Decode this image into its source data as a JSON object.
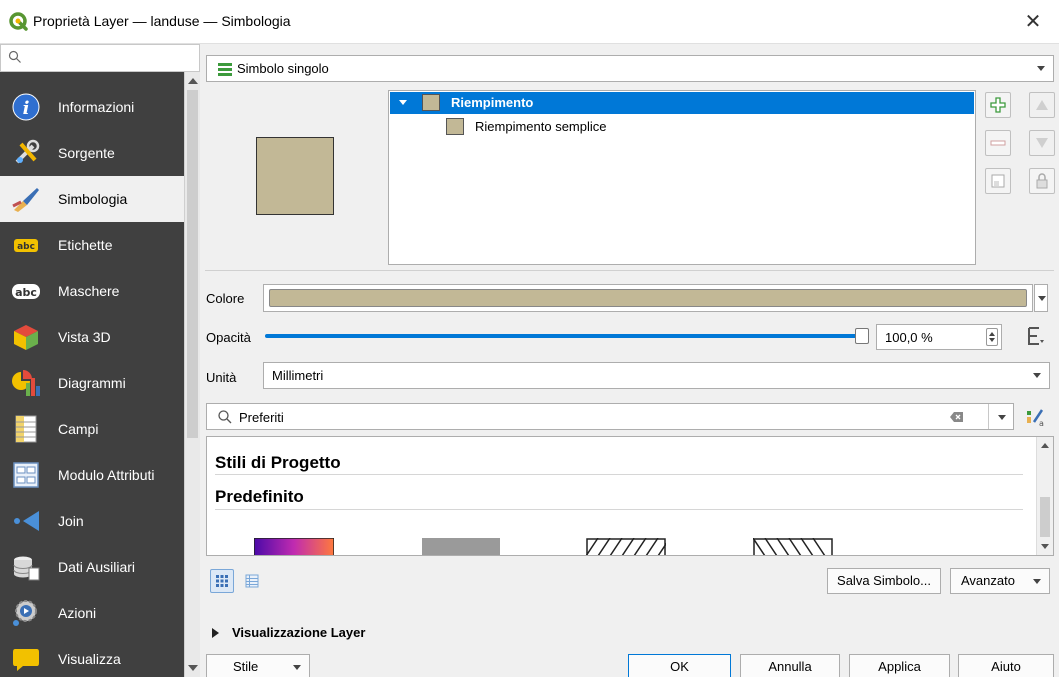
{
  "window": {
    "title": "Proprietà Layer — landuse — Simbologia",
    "close_glyph": "✕"
  },
  "sidebar": {
    "items": [
      {
        "label": "Informazioni",
        "icon": "info-icon"
      },
      {
        "label": "Sorgente",
        "icon": "source-icon"
      },
      {
        "label": "Simbologia",
        "icon": "symbology-icon",
        "active": true
      },
      {
        "label": "Etichette",
        "icon": "labels-icon"
      },
      {
        "label": "Maschere",
        "icon": "masks-icon"
      },
      {
        "label": "Vista 3D",
        "icon": "3d-view-icon"
      },
      {
        "label": "Diagrammi",
        "icon": "diagrams-icon"
      },
      {
        "label": "Campi",
        "icon": "fields-icon"
      },
      {
        "label": "Modulo Attributi",
        "icon": "attributes-form-icon"
      },
      {
        "label": "Join",
        "icon": "join-icon"
      },
      {
        "label": "Dati Ausiliari",
        "icon": "auxiliary-data-icon"
      },
      {
        "label": "Azioni",
        "icon": "actions-icon"
      },
      {
        "label": "Visualizza",
        "icon": "display-icon"
      }
    ]
  },
  "renderer": {
    "selected": "Simbolo singolo"
  },
  "symbol_tree": {
    "root": "Riempimento",
    "child": "Riempimento semplice",
    "fill_color": "#c2b896"
  },
  "properties": {
    "color_label": "Colore",
    "opacity_label": "Opacità",
    "opacity_value": "100,0 %",
    "opacity_fraction": 1.0,
    "unit_label": "Unità",
    "unit_value": "Millimetri"
  },
  "library": {
    "search_value": "Preferiti",
    "groups": [
      "Stili di Progetto",
      "Predefinito"
    ]
  },
  "buttons": {
    "save_symbol": "Salva Simbolo...",
    "advanced": "Avanzato",
    "style": "Stile",
    "ok": "OK",
    "cancel": "Annulla",
    "apply": "Applica",
    "help": "Aiuto"
  },
  "layer_rendering": {
    "label": "Visualizzazione Layer"
  },
  "colors": {
    "accent": "#0078d7",
    "sidebar_bg": "#404040",
    "fill": "#c2b896"
  }
}
